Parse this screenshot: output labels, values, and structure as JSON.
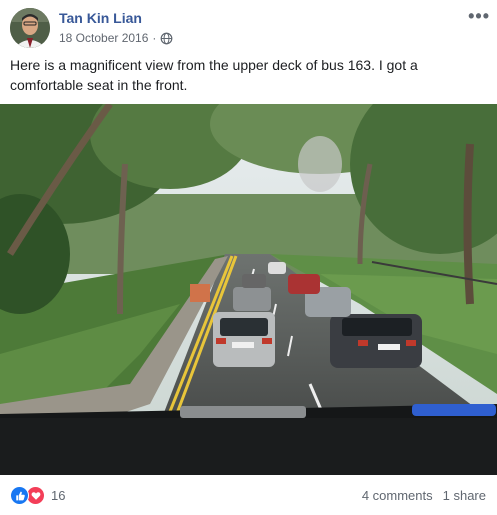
{
  "post": {
    "author": "Tan Kin Lian",
    "date": "18 October 2016",
    "date_separator": "·",
    "more_options": "•••",
    "text": "Here is a magnificent view from the upper deck of bus 163. I got a comfortable seat in the front.",
    "reaction_count": "16",
    "comments": "4 comments",
    "shares": "1 share"
  },
  "icons": {
    "more": "more-options-icon",
    "privacy": "globe-icon",
    "like": "thumbs-up-icon",
    "love": "heart-icon"
  },
  "colors": {
    "author_link": "#385898",
    "like": "#1877f2",
    "love": "#f33e58",
    "meta_text": "#616770"
  }
}
